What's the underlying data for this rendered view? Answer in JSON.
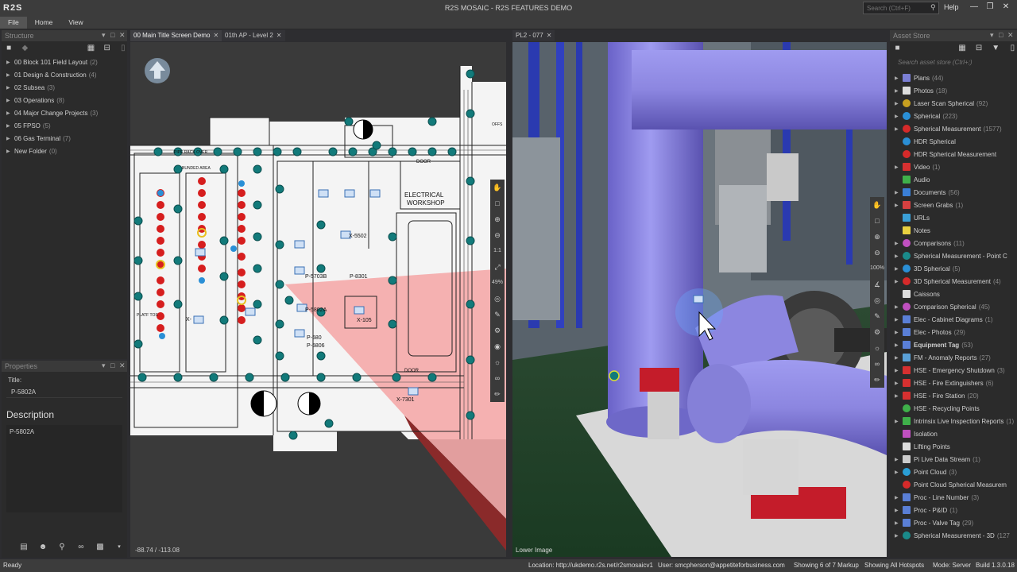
{
  "app": {
    "logo": "R2S",
    "title": "R2S MOSAIC - R2S FEATURES DEMO",
    "search_placeholder": "Search (Ctrl+F)",
    "help": "Help"
  },
  "menu": [
    "File",
    "Home",
    "View"
  ],
  "structure": {
    "title": "Structure",
    "items": [
      {
        "label": "00 Block 101 Field Layout",
        "count": "(2)"
      },
      {
        "label": "01 Design & Construction",
        "count": "(4)"
      },
      {
        "label": "02 Subsea",
        "count": "(3)"
      },
      {
        "label": "03 Operations",
        "count": "(8)"
      },
      {
        "label": "04 Major Change Projects",
        "count": "(3)"
      },
      {
        "label": "05 FPSO",
        "count": "(5)"
      },
      {
        "label": "06 Gas Terminal",
        "count": "(7)"
      },
      {
        "label": "New Folder",
        "count": "(0)"
      }
    ]
  },
  "properties": {
    "title": "Properties",
    "title_label": "Title:",
    "title_value": "P-5802A",
    "description_label": "Description",
    "description_value": "P-5802A"
  },
  "tabs": {
    "tab1": "00 Main Title Screen Demo",
    "tab2": "01th AP - Level 2",
    "tab3": "PL2 - 077"
  },
  "plan": {
    "coords": "-88.74 / -113.08",
    "zoom": "49%",
    "scale": "1:1",
    "labels": {
      "electrical": "ELECTRICAL",
      "workshop": "WORKSHOP",
      "door1": "DOOR",
      "door2": "DOOR",
      "bunded": "BUNDED AREA",
      "pipe_rack": "PIPE RACK OVER",
      "x5502": "X-5502",
      "p5703b": "P-5703B",
      "p8301": "P-8301",
      "p5802a": "P-5802A",
      "p5806": "P-5806",
      "p580": "P-580",
      "x7301": "X-7301",
      "x105": "X-105",
      "xdash": "X-",
      "platfos": "PLATF TOS",
      "offs": "OFFS"
    }
  },
  "view3d": {
    "label": "Lower Image",
    "zoom": "100%"
  },
  "asset_store": {
    "title": "Asset Store",
    "search_placeholder": "Search asset store (Ctrl+;)",
    "items": [
      {
        "label": "Plans",
        "count": "(44)",
        "color": "#7b7fd4",
        "shape": "sq",
        "arrow": true
      },
      {
        "label": "Photos",
        "count": "(18)",
        "color": "#dddddd",
        "shape": "sq",
        "arrow": true
      },
      {
        "label": "Laser Scan Spherical",
        "count": "(92)",
        "color": "#c8a020",
        "shape": "circle",
        "arrow": true
      },
      {
        "label": "Spherical",
        "count": "(223)",
        "color": "#2a8fd6",
        "shape": "circle",
        "arrow": true
      },
      {
        "label": "Spherical Measurement",
        "count": "(1577)",
        "color": "#d62a2a",
        "shape": "circle",
        "arrow": true
      },
      {
        "label": "HDR Spherical",
        "count": "",
        "color": "#2a8fd6",
        "shape": "circle",
        "arrow": false
      },
      {
        "label": "HDR Spherical Measurement",
        "count": "",
        "color": "#d62a2a",
        "shape": "circle",
        "arrow": false
      },
      {
        "label": "Video",
        "count": "(1)",
        "color": "#d63030",
        "shape": "sq",
        "arrow": true
      },
      {
        "label": "Audio",
        "count": "",
        "color": "#3fb04a",
        "shape": "sq",
        "arrow": false
      },
      {
        "label": "Documents",
        "count": "(56)",
        "color": "#3a7fd6",
        "shape": "sq",
        "arrow": true
      },
      {
        "label": "Screen Grabs",
        "count": "(1)",
        "color": "#d64040",
        "shape": "sq",
        "arrow": true
      },
      {
        "label": "URLs",
        "count": "",
        "color": "#3a9fd6",
        "shape": "sq",
        "arrow": false
      },
      {
        "label": "Notes",
        "count": "",
        "color": "#e8d040",
        "shape": "sq",
        "arrow": false
      },
      {
        "label": "Comparisons",
        "count": "(11)",
        "color": "#c050c0",
        "shape": "circle",
        "arrow": true
      },
      {
        "label": "Spherical Measurement - Point C",
        "count": "",
        "color": "#1a8a8a",
        "shape": "circle",
        "arrow": true
      },
      {
        "label": "3D Spherical",
        "count": "(5)",
        "color": "#2a8fd6",
        "shape": "circle",
        "arrow": true
      },
      {
        "label": "3D Spherical Measurement",
        "count": "(4)",
        "color": "#d62a2a",
        "shape": "circle",
        "arrow": true
      },
      {
        "label": "Caissons",
        "count": "",
        "color": "#dddddd",
        "shape": "sq",
        "arrow": false
      },
      {
        "label": "Comparison Spherical",
        "count": "(45)",
        "color": "#c050c0",
        "shape": "circle",
        "arrow": true
      },
      {
        "label": "Elec - Cabinet Diagrams",
        "count": "(1)",
        "color": "#5a7fd6",
        "shape": "sq",
        "arrow": true
      },
      {
        "label": "Elec - Photos",
        "count": "(29)",
        "color": "#5a7fd6",
        "shape": "sq",
        "arrow": true
      },
      {
        "label": "Equipment Tag",
        "count": "(53)",
        "color": "#5a7fd6",
        "shape": "sq",
        "arrow": true,
        "bold": true
      },
      {
        "label": "FM - Anomaly Reports",
        "count": "(27)",
        "color": "#5aa0d6",
        "shape": "sq",
        "arrow": true
      },
      {
        "label": "HSE - Emergency Shutdown",
        "count": "(3)",
        "color": "#d63030",
        "shape": "sq",
        "arrow": true
      },
      {
        "label": "HSE - Fire Extinguishers",
        "count": "(6)",
        "color": "#d63030",
        "shape": "sq",
        "arrow": true
      },
      {
        "label": "HSE - Fire Station",
        "count": "(20)",
        "color": "#d63030",
        "shape": "sq",
        "arrow": true
      },
      {
        "label": "HSE - Recycling Points",
        "count": "",
        "color": "#3fb04a",
        "shape": "circle",
        "arrow": false
      },
      {
        "label": "Intrinsix Live Inspection Reports",
        "count": "(1)",
        "color": "#3fb04a",
        "shape": "sq",
        "arrow": true
      },
      {
        "label": "Isolation",
        "count": "",
        "color": "#c050c0",
        "shape": "sq",
        "arrow": false
      },
      {
        "label": "Lifting Points",
        "count": "",
        "color": "#dddddd",
        "shape": "sq",
        "arrow": false
      },
      {
        "label": "Pi Live Data Stream",
        "count": "(1)",
        "color": "#cccccc",
        "shape": "sq",
        "arrow": true
      },
      {
        "label": "Point Cloud",
        "count": "(3)",
        "color": "#2a9fd6",
        "shape": "circle",
        "arrow": true
      },
      {
        "label": "Point Cloud Spherical Measurem",
        "count": "",
        "color": "#d62a2a",
        "shape": "circle",
        "arrow": false
      },
      {
        "label": "Proc - Line Number",
        "count": "(3)",
        "color": "#5a7fd6",
        "shape": "sq",
        "arrow": true
      },
      {
        "label": "Proc - P&ID",
        "count": "(1)",
        "color": "#5a7fd6",
        "shape": "sq",
        "arrow": true
      },
      {
        "label": "Proc - Valve Tag",
        "count": "(29)",
        "color": "#5a7fd6",
        "shape": "sq",
        "arrow": true
      },
      {
        "label": "Spherical Measurement - 3D",
        "count": "(127",
        "color": "#1a8a8a",
        "shape": "circle",
        "arrow": true
      }
    ]
  },
  "status": {
    "ready": "Ready",
    "location": "Location: http://ukdemo.r2s.net/r2smosaicv1",
    "user": "User: smcpherson@appetiteforbusiness.com",
    "showing": "Showing 6 of 7 Markup",
    "hotspots": "Showing All Hotspots",
    "mode": "Mode: Server",
    "build": "Build 1.3.0.18"
  }
}
